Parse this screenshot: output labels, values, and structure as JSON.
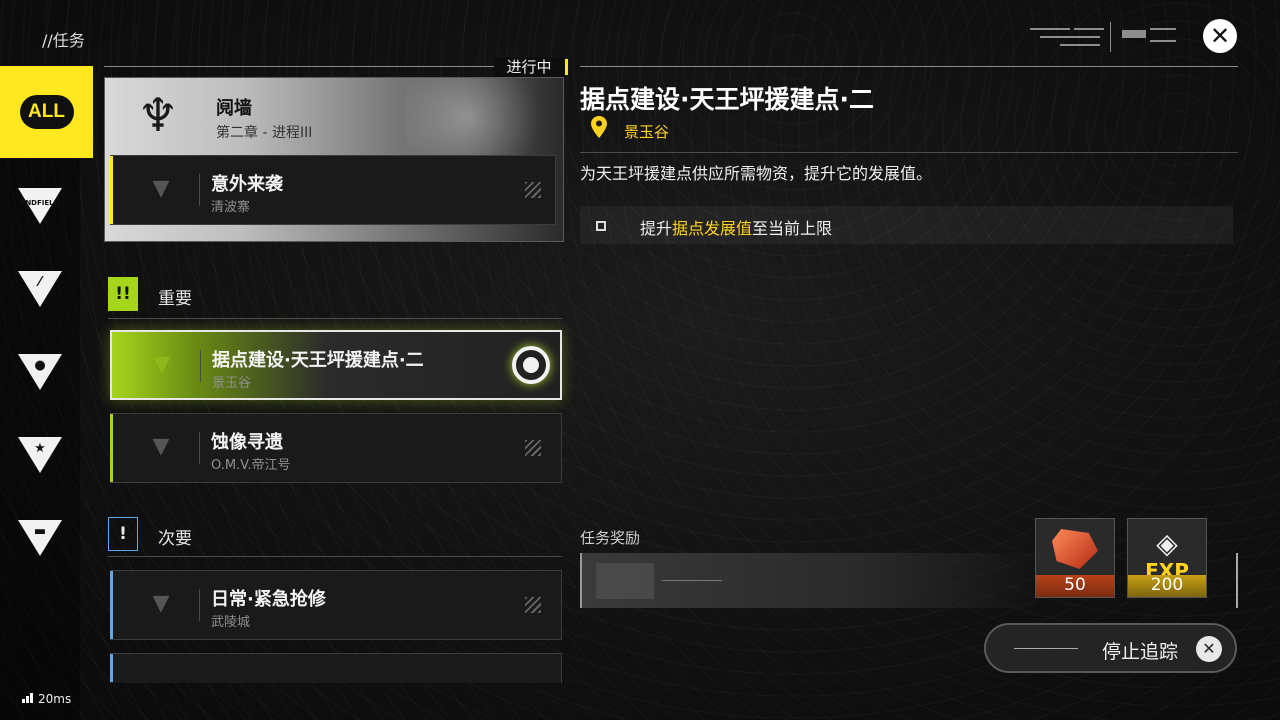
{
  "header": {
    "breadcrumb": "//任务",
    "close_icon": "close-icon"
  },
  "sidebar": {
    "items": [
      {
        "label": "ALL",
        "icon": "all-icon",
        "active": true
      },
      {
        "label": "ENDFIELD",
        "icon": "endfield-icon"
      },
      {
        "label": "",
        "icon": "slash-icon"
      },
      {
        "label": "",
        "icon": "person-icon"
      },
      {
        "label": "",
        "icon": "star-icon"
      },
      {
        "label": "",
        "icon": "battery-icon"
      }
    ]
  },
  "progress": {
    "status": "进行中",
    "chapter_title": "阋墙",
    "chapter_sub": "第二章 - 进程III",
    "sub_quest": {
      "title": "意外来袭",
      "location": "清波寨"
    }
  },
  "sections": {
    "important": {
      "icon": "!!",
      "label": "重要"
    },
    "minor": {
      "icon": "!",
      "label": "次要"
    }
  },
  "quests": {
    "selected": {
      "title": "据点建设·天王坪援建点·二",
      "location": "景玉谷"
    },
    "important_2": {
      "title": "蚀像寻遗",
      "location": "O.M.V.帝江号"
    },
    "minor_1": {
      "title": "日常·紧急抢修",
      "location": "武陵城"
    }
  },
  "detail": {
    "title": "据点建设·天王坪援建点·二",
    "location": "景玉谷",
    "description": "为天王坪援建点供应所需物资，提升它的发展值。",
    "objective_pre": "提升",
    "objective_hl": "据点发展值",
    "objective_post": "至当前上限"
  },
  "rewards": {
    "label": "任务奖励",
    "items": [
      {
        "name": "crystal-reward-icon",
        "qty": "50"
      },
      {
        "name": "exp-reward-icon",
        "label": "EXP",
        "qty": "200"
      }
    ]
  },
  "actions": {
    "stop_tracking": "停止追踪"
  },
  "status_bar": {
    "ping": "20ms"
  },
  "colors": {
    "accent_yellow": "#ffe81f",
    "accent_green": "#a6d51d",
    "minor_blue": "#5fa8e8"
  }
}
